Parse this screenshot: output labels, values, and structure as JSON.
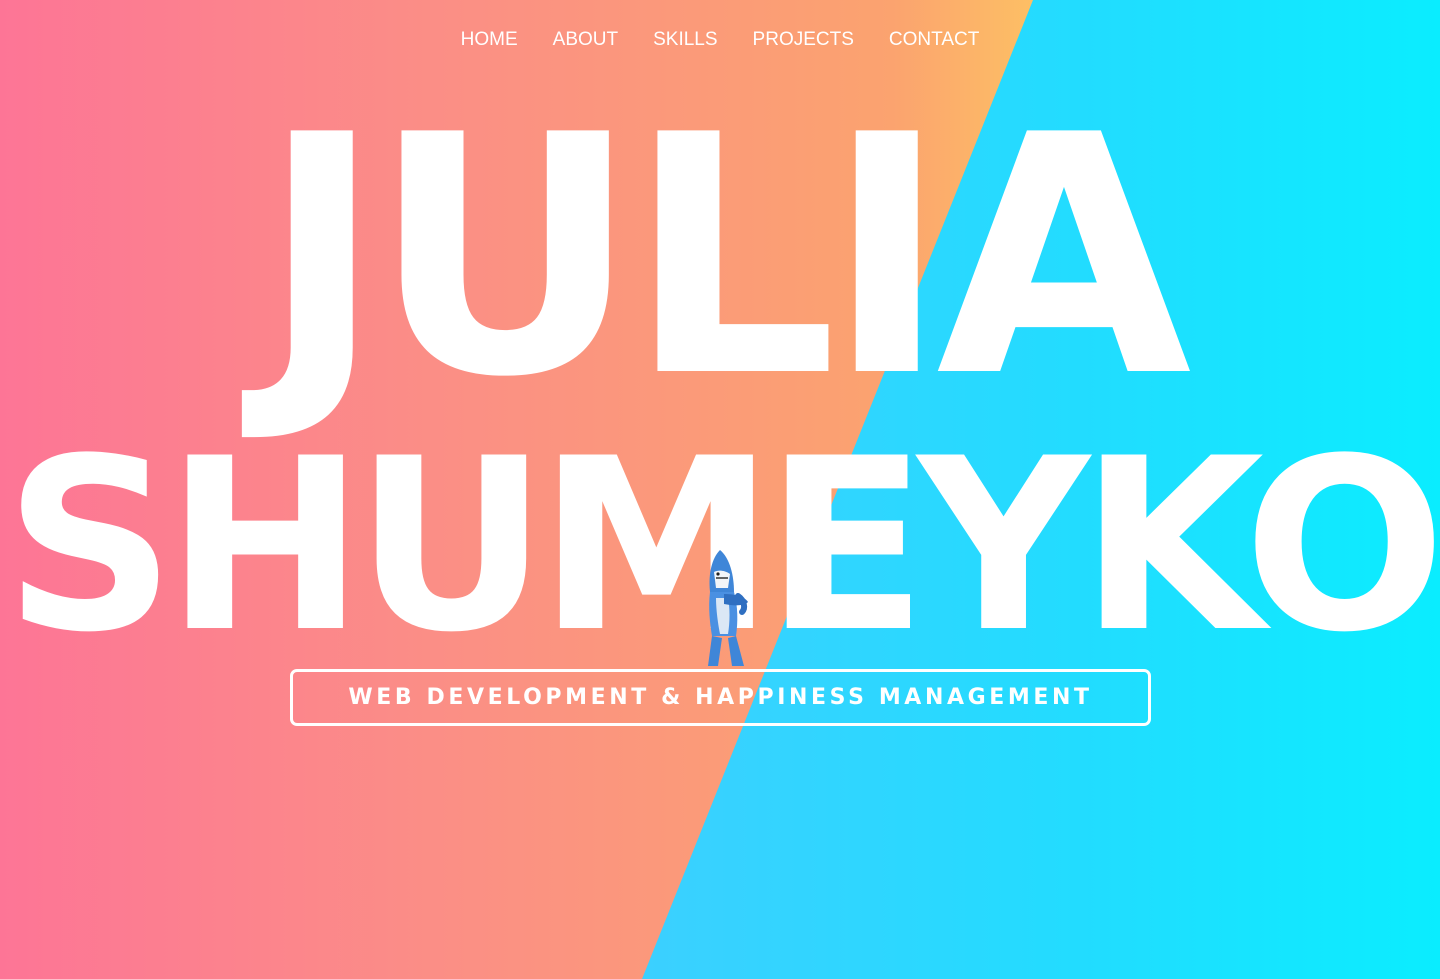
{
  "nav": {
    "items": [
      {
        "label": "HOME"
      },
      {
        "label": "ABOUT"
      },
      {
        "label": "SKILLS"
      },
      {
        "label": "PROJECTS"
      },
      {
        "label": "CONTACT"
      }
    ]
  },
  "hero": {
    "first_name": "JULIA",
    "last_name": "SHUMEYKO",
    "tagline": "WEB DEVELOPMENT & HAPPINESS MANAGEMENT",
    "mascot_icon": "dancing-shark-icon"
  },
  "colors": {
    "warm_gradient_start": "#fd7596",
    "warm_gradient_end": "#fdc064",
    "cool_gradient_start": "#3bd0ff",
    "cool_gradient_end": "#0aedff",
    "text": "#ffffff"
  }
}
